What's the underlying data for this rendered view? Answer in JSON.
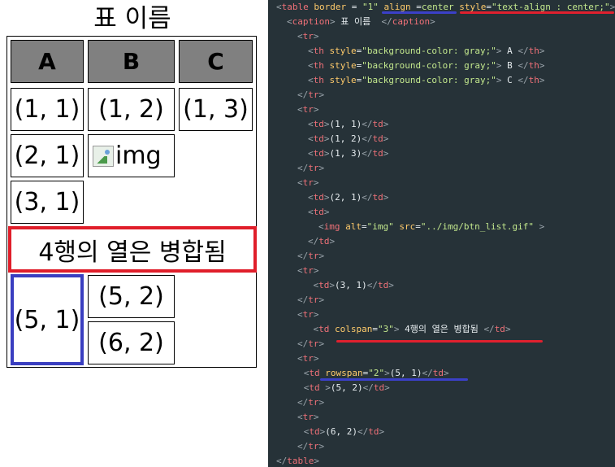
{
  "table": {
    "caption": "표 이름",
    "headers": [
      "A",
      "B",
      "C"
    ],
    "cells": {
      "r1": [
        "(1, 1)",
        "(1, 2)",
        "(1, 3)"
      ],
      "r2c1": "(2, 1)",
      "img_alt": "img",
      "r3c1": "(3, 1)",
      "merged_row": "4행의 열은 병합됨",
      "r5c1": "(5, 1)",
      "r5c2": "(5, 2)",
      "r6c2": "(6, 2)"
    }
  },
  "colors": {
    "header_bg": "#808080",
    "colspan_highlight": "#e01e2a",
    "rowspan_highlight": "#3a3ec0",
    "code_bg": "#263238"
  },
  "code_lines": [
    {
      "indent": 0,
      "tokens": [
        {
          "c": "p",
          "v": "<"
        },
        {
          "c": "t",
          "v": "table"
        },
        {
          "c": "a",
          "v": " border"
        },
        {
          "c": "x",
          "v": " = "
        },
        {
          "c": "s",
          "v": "\"1\""
        },
        {
          "c": "a",
          "v": " align"
        },
        {
          "c": "x",
          "v": " ="
        },
        {
          "c": "s",
          "v": "center"
        },
        {
          "c": "a",
          "v": " style"
        },
        {
          "c": "x",
          "v": "="
        },
        {
          "c": "s",
          "v": "\"text-align : center;\""
        },
        {
          "c": "p",
          "v": ">"
        }
      ]
    },
    {
      "indent": 1,
      "tokens": [
        {
          "c": "p",
          "v": "<"
        },
        {
          "c": "t",
          "v": "caption"
        },
        {
          "c": "p",
          "v": ">"
        },
        {
          "c": "x",
          "v": " 표 이름  "
        },
        {
          "c": "p",
          "v": "</"
        },
        {
          "c": "t",
          "v": "caption"
        },
        {
          "c": "p",
          "v": ">"
        }
      ]
    },
    {
      "indent": 2,
      "tokens": [
        {
          "c": "p",
          "v": "<"
        },
        {
          "c": "t",
          "v": "tr"
        },
        {
          "c": "p",
          "v": ">"
        }
      ]
    },
    {
      "indent": 3,
      "tokens": [
        {
          "c": "p",
          "v": "<"
        },
        {
          "c": "t",
          "v": "th"
        },
        {
          "c": "a",
          "v": " style"
        },
        {
          "c": "x",
          "v": "="
        },
        {
          "c": "s",
          "v": "\"background-color: gray;\""
        },
        {
          "c": "p",
          "v": ">"
        },
        {
          "c": "x",
          "v": " A "
        },
        {
          "c": "p",
          "v": "</"
        },
        {
          "c": "t",
          "v": "th"
        },
        {
          "c": "p",
          "v": ">"
        }
      ]
    },
    {
      "indent": 3,
      "tokens": [
        {
          "c": "p",
          "v": "<"
        },
        {
          "c": "t",
          "v": "th"
        },
        {
          "c": "a",
          "v": " style"
        },
        {
          "c": "x",
          "v": "="
        },
        {
          "c": "s",
          "v": "\"background-color: gray;\""
        },
        {
          "c": "p",
          "v": ">"
        },
        {
          "c": "x",
          "v": " B "
        },
        {
          "c": "p",
          "v": "</"
        },
        {
          "c": "t",
          "v": "th"
        },
        {
          "c": "p",
          "v": ">"
        }
      ]
    },
    {
      "indent": 3,
      "tokens": [
        {
          "c": "p",
          "v": "<"
        },
        {
          "c": "t",
          "v": "th"
        },
        {
          "c": "a",
          "v": " style"
        },
        {
          "c": "x",
          "v": "="
        },
        {
          "c": "s",
          "v": "\"background-color: gray;\""
        },
        {
          "c": "p",
          "v": ">"
        },
        {
          "c": "x",
          "v": " C "
        },
        {
          "c": "p",
          "v": "</"
        },
        {
          "c": "t",
          "v": "th"
        },
        {
          "c": "p",
          "v": ">"
        }
      ]
    },
    {
      "indent": 2,
      "tokens": [
        {
          "c": "p",
          "v": "</"
        },
        {
          "c": "t",
          "v": "tr"
        },
        {
          "c": "p",
          "v": ">"
        }
      ]
    },
    {
      "indent": 2,
      "tokens": [
        {
          "c": "p",
          "v": "<"
        },
        {
          "c": "t",
          "v": "tr"
        },
        {
          "c": "p",
          "v": ">"
        }
      ]
    },
    {
      "indent": 3,
      "tokens": [
        {
          "c": "p",
          "v": "<"
        },
        {
          "c": "t",
          "v": "td"
        },
        {
          "c": "p",
          "v": ">"
        },
        {
          "c": "x",
          "v": "(1, 1)"
        },
        {
          "c": "p",
          "v": "</"
        },
        {
          "c": "t",
          "v": "td"
        },
        {
          "c": "p",
          "v": ">"
        }
      ]
    },
    {
      "indent": 3,
      "tokens": [
        {
          "c": "p",
          "v": "<"
        },
        {
          "c": "t",
          "v": "td"
        },
        {
          "c": "p",
          "v": ">"
        },
        {
          "c": "x",
          "v": "(1, 2)"
        },
        {
          "c": "p",
          "v": "</"
        },
        {
          "c": "t",
          "v": "td"
        },
        {
          "c": "p",
          "v": ">"
        }
      ]
    },
    {
      "indent": 3,
      "tokens": [
        {
          "c": "p",
          "v": "<"
        },
        {
          "c": "t",
          "v": "td"
        },
        {
          "c": "p",
          "v": ">"
        },
        {
          "c": "x",
          "v": "(1, 3)"
        },
        {
          "c": "p",
          "v": "</"
        },
        {
          "c": "t",
          "v": "td"
        },
        {
          "c": "p",
          "v": ">"
        }
      ]
    },
    {
      "indent": 2,
      "tokens": [
        {
          "c": "p",
          "v": "</"
        },
        {
          "c": "t",
          "v": "tr"
        },
        {
          "c": "p",
          "v": ">"
        }
      ]
    },
    {
      "indent": 2,
      "tokens": [
        {
          "c": "p",
          "v": "<"
        },
        {
          "c": "t",
          "v": "tr"
        },
        {
          "c": "p",
          "v": ">"
        }
      ]
    },
    {
      "indent": 3,
      "tokens": [
        {
          "c": "p",
          "v": "<"
        },
        {
          "c": "t",
          "v": "td"
        },
        {
          "c": "p",
          "v": ">"
        },
        {
          "c": "x",
          "v": "(2, 1)"
        },
        {
          "c": "p",
          "v": "</"
        },
        {
          "c": "t",
          "v": "td"
        },
        {
          "c": "p",
          "v": ">"
        }
      ]
    },
    {
      "indent": 3,
      "tokens": [
        {
          "c": "p",
          "v": "<"
        },
        {
          "c": "t",
          "v": "td"
        },
        {
          "c": "p",
          "v": ">"
        }
      ]
    },
    {
      "indent": 4,
      "tokens": [
        {
          "c": "p",
          "v": "<"
        },
        {
          "c": "t",
          "v": "img"
        },
        {
          "c": "a",
          "v": " alt"
        },
        {
          "c": "x",
          "v": "="
        },
        {
          "c": "s",
          "v": "\"img\""
        },
        {
          "c": "a",
          "v": " src"
        },
        {
          "c": "x",
          "v": "="
        },
        {
          "c": "s",
          "v": "\"../img/btn_list.gif\""
        },
        {
          "c": "p",
          "v": " >"
        }
      ]
    },
    {
      "indent": 3,
      "tokens": [
        {
          "c": "p",
          "v": "</"
        },
        {
          "c": "t",
          "v": "td"
        },
        {
          "c": "p",
          "v": ">"
        }
      ]
    },
    {
      "indent": 2,
      "tokens": [
        {
          "c": "p",
          "v": "</"
        },
        {
          "c": "t",
          "v": "tr"
        },
        {
          "c": "p",
          "v": ">"
        }
      ]
    },
    {
      "indent": 2,
      "tokens": [
        {
          "c": "p",
          "v": "<"
        },
        {
          "c": "t",
          "v": "tr"
        },
        {
          "c": "p",
          "v": ">"
        }
      ]
    },
    {
      "indent": 3.5,
      "tokens": [
        {
          "c": "p",
          "v": "<"
        },
        {
          "c": "t",
          "v": "td"
        },
        {
          "c": "p",
          "v": ">"
        },
        {
          "c": "x",
          "v": "(3, 1)"
        },
        {
          "c": "p",
          "v": "</"
        },
        {
          "c": "t",
          "v": "td"
        },
        {
          "c": "p",
          "v": ">"
        }
      ]
    },
    {
      "indent": 2,
      "tokens": [
        {
          "c": "p",
          "v": "</"
        },
        {
          "c": "t",
          "v": "tr"
        },
        {
          "c": "p",
          "v": ">"
        }
      ]
    },
    {
      "indent": 2,
      "tokens": [
        {
          "c": "p",
          "v": "<"
        },
        {
          "c": "t",
          "v": "tr"
        },
        {
          "c": "p",
          "v": ">"
        }
      ]
    },
    {
      "indent": 3.5,
      "tokens": [
        {
          "c": "p",
          "v": "<"
        },
        {
          "c": "t",
          "v": "td"
        },
        {
          "c": "a",
          "v": " colspan"
        },
        {
          "c": "x",
          "v": "="
        },
        {
          "c": "s",
          "v": "\"3\""
        },
        {
          "c": "p",
          "v": ">"
        },
        {
          "c": "x",
          "v": " 4행의 열은 병합됨 "
        },
        {
          "c": "p",
          "v": "</"
        },
        {
          "c": "t",
          "v": "td"
        },
        {
          "c": "p",
          "v": ">"
        }
      ]
    },
    {
      "indent": 2,
      "tokens": [
        {
          "c": "p",
          "v": "</"
        },
        {
          "c": "t",
          "v": "tr"
        },
        {
          "c": "p",
          "v": ">"
        }
      ]
    },
    {
      "indent": 2,
      "tokens": [
        {
          "c": "p",
          "v": "<"
        },
        {
          "c": "t",
          "v": "tr"
        },
        {
          "c": "p",
          "v": ">"
        }
      ]
    },
    {
      "indent": 2.6,
      "tokens": [
        {
          "c": "p",
          "v": "<"
        },
        {
          "c": "t",
          "v": "td"
        },
        {
          "c": "a",
          "v": " rowspan"
        },
        {
          "c": "x",
          "v": "="
        },
        {
          "c": "s",
          "v": "\"2\""
        },
        {
          "c": "p",
          "v": ">"
        },
        {
          "c": "x",
          "v": "(5, 1)"
        },
        {
          "c": "p",
          "v": "</"
        },
        {
          "c": "t",
          "v": "td"
        },
        {
          "c": "p",
          "v": ">"
        }
      ]
    },
    {
      "indent": 2.6,
      "tokens": [
        {
          "c": "p",
          "v": "<"
        },
        {
          "c": "t",
          "v": "td"
        },
        {
          "c": "p",
          "v": " >"
        },
        {
          "c": "x",
          "v": "(5, 2)"
        },
        {
          "c": "p",
          "v": "</"
        },
        {
          "c": "t",
          "v": "td"
        },
        {
          "c": "p",
          "v": ">"
        }
      ]
    },
    {
      "indent": 2,
      "tokens": [
        {
          "c": "p",
          "v": "</"
        },
        {
          "c": "t",
          "v": "tr"
        },
        {
          "c": "p",
          "v": ">"
        }
      ]
    },
    {
      "indent": 2,
      "tokens": [
        {
          "c": "p",
          "v": "<"
        },
        {
          "c": "t",
          "v": "tr"
        },
        {
          "c": "p",
          "v": ">"
        }
      ]
    },
    {
      "indent": 2.6,
      "tokens": [
        {
          "c": "p",
          "v": "<"
        },
        {
          "c": "t",
          "v": "td"
        },
        {
          "c": "p",
          "v": ">"
        },
        {
          "c": "x",
          "v": "(6, 2)"
        },
        {
          "c": "p",
          "v": "</"
        },
        {
          "c": "t",
          "v": "td"
        },
        {
          "c": "p",
          "v": ">"
        }
      ]
    },
    {
      "indent": 2,
      "tokens": [
        {
          "c": "p",
          "v": "</"
        },
        {
          "c": "t",
          "v": "tr"
        },
        {
          "c": "p",
          "v": ">"
        }
      ]
    },
    {
      "indent": 0,
      "tokens": [
        {
          "c": "p",
          "v": "</"
        },
        {
          "c": "t",
          "v": "table"
        },
        {
          "c": "p",
          "v": ">"
        }
      ]
    }
  ]
}
